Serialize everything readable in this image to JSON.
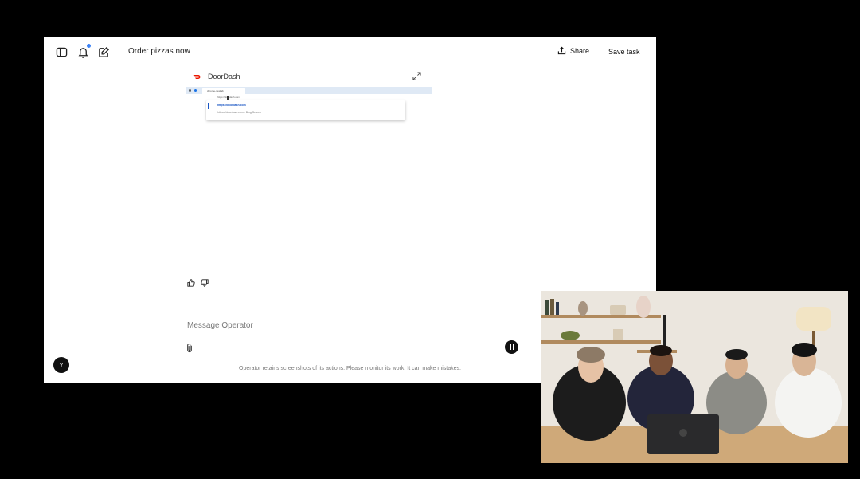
{
  "colors": {
    "notification_dot": "#3b82f6",
    "brand_doordash": "#eb1700",
    "pause_button": "#111111",
    "link_blue": "#1a56c4"
  },
  "header": {
    "task_title": "Order pizzas now",
    "share_label": "Share",
    "save_label": "Save task"
  },
  "browser_panel": {
    "site_name": "DoorDash",
    "tab_title": "chrome-newtab",
    "address_text": "https://doordash.com",
    "suggestions": [
      "https://doordash.com",
      "https://doordash.com - Bing Search"
    ]
  },
  "composer": {
    "placeholder": "Message Operator"
  },
  "user": {
    "avatar_initial": "Y"
  },
  "footer": {
    "disclaimer": "Operator retains screenshots of its actions. Please monitor its work. It can make mistakes."
  },
  "icons": [
    "sidebar-icon",
    "notification-icon",
    "edit-icon",
    "share-icon",
    "doordash-logo-icon",
    "expand-icon",
    "thumbs-up-icon",
    "thumbs-down-icon",
    "attach-icon",
    "pause-icon"
  ]
}
